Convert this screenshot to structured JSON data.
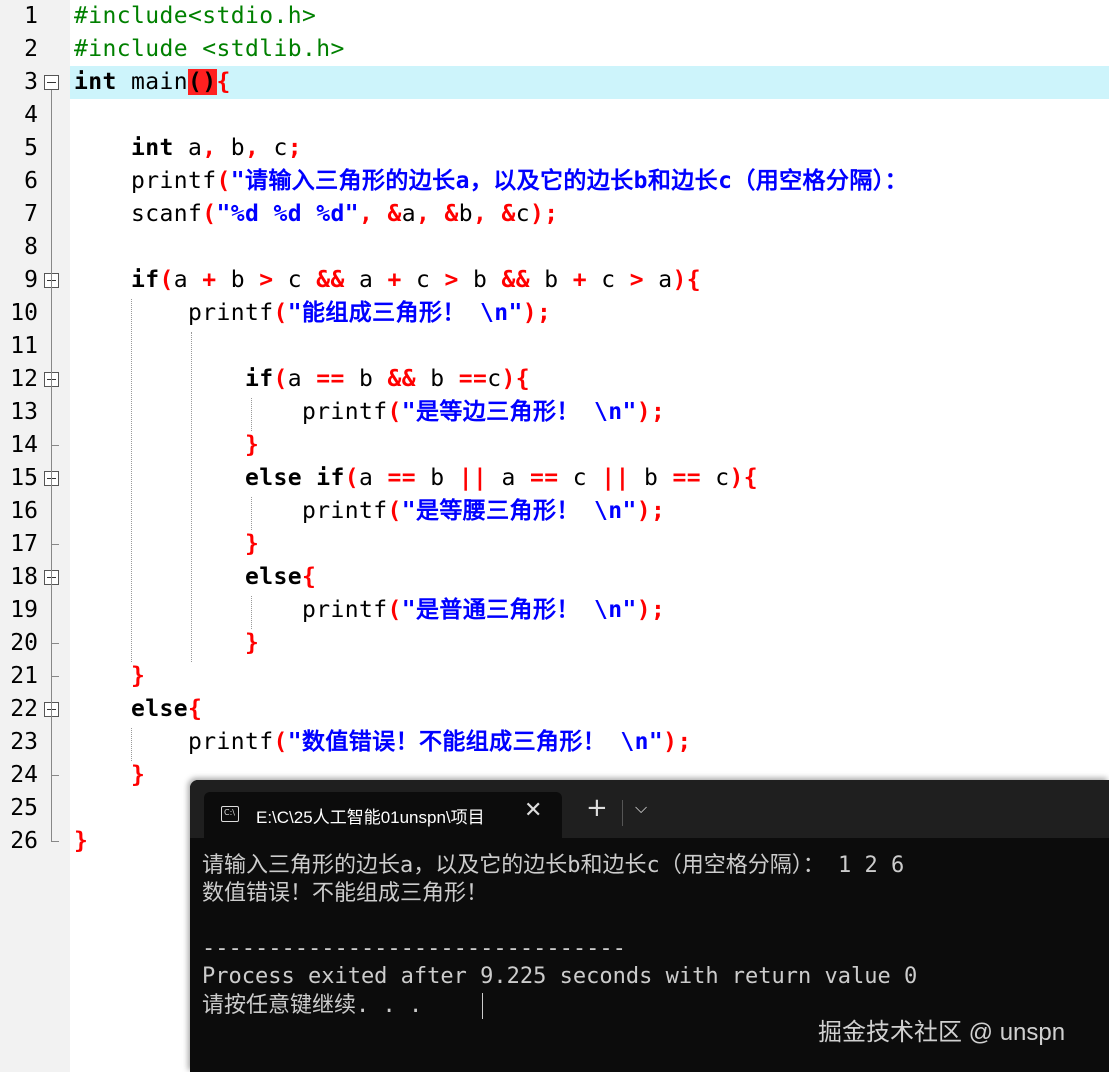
{
  "editor": {
    "line_numbers": [
      "1",
      "2",
      "3",
      "4",
      "5",
      "6",
      "7",
      "8",
      "9",
      "10",
      "11",
      "12",
      "13",
      "14",
      "15",
      "16",
      "17",
      "18",
      "19",
      "20",
      "21",
      "22",
      "23",
      "24",
      "25",
      "26"
    ],
    "current_line": "3",
    "code": [
      "#include<stdio.h>",
      "#include <stdlib.h>",
      "int main(){",
      "",
      "    int a, b, c;",
      "    printf(\"请输入三角形的边长a，以及它的边长b和边长c（用空格分隔）：",
      "    scanf(\"%d %d %d\", &a, &b, &c);",
      "",
      "    if(a + b > c && a + c > b && b + c > a){",
      "        printf(\"能组成三角形！ \\n\");",
      "",
      "            if(a == b && b ==c){",
      "                printf(\"是等边三角形！ \\n\");",
      "            }",
      "            else if(a == b || a == c || b == c){",
      "                printf(\"是等腰三角形！ \\n\");",
      "            }",
      "            else{",
      "                printf(\"是普通三角形！ \\n\");",
      "            }",
      "    }",
      "    else{",
      "        printf(\"数值错误！不能组成三角形！ \\n\");",
      "    }",
      "",
      "}"
    ]
  },
  "terminal": {
    "tab_icon": "C:\\",
    "tab_title": "E:\\C\\25人工智能01unspn\\项目",
    "close_glyph": "✕",
    "new_tab_glyph": "+",
    "dropdown_glyph": "⌵",
    "lines": [
      "请输入三角形的边长a，以及它的边长b和边长c（用空格分隔）： 1 2 6",
      "数值错误！不能组成三角形！",
      "",
      "--------------------------------",
      "Process exited after 9.225 seconds with return value 0",
      "请按任意键继续. . ."
    ]
  },
  "watermark": "掘金技术社区 @ unspn"
}
